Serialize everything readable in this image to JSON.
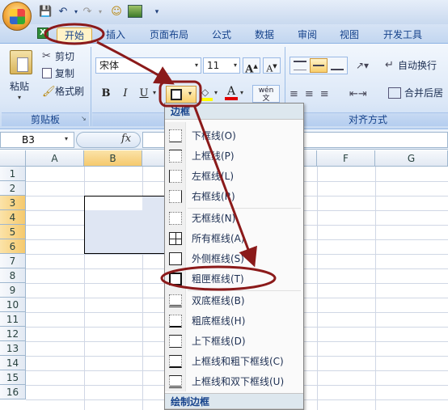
{
  "quick_access": {
    "icons": [
      "excel-office-button",
      "save-icon",
      "undo-icon",
      "redo-icon",
      "smiley-icon",
      "picture-icon",
      "customize-arrow-icon"
    ]
  },
  "tabs": {
    "home": "开始",
    "insert": "插入",
    "page_layout": "页面布局",
    "formulas": "公式",
    "data": "数据",
    "review": "审阅",
    "view": "视图",
    "developer": "开发工具"
  },
  "clipboard": {
    "paste": "粘贴",
    "cut": "剪切",
    "copy": "复制",
    "format_painter": "格式刷",
    "group_label": "剪贴板"
  },
  "font": {
    "name": "宋体",
    "size": "11",
    "bold": "B",
    "italic": "I",
    "underline": "U",
    "grow": "A",
    "shrink": "A",
    "phonetic": "wén"
  },
  "alignment": {
    "wrap_text": "自动换行",
    "merge_center": "合并后居",
    "group_label": "对齐方式"
  },
  "formula_bar": {
    "name_box": "B3",
    "fx": "fx",
    "value": ""
  },
  "columns": [
    "A",
    "B",
    "C",
    "D",
    "E",
    "F",
    "G"
  ],
  "rows": [
    "1",
    "2",
    "3",
    "4",
    "5",
    "6",
    "7",
    "8",
    "9",
    "10",
    "11",
    "12",
    "13",
    "14",
    "15",
    "16"
  ],
  "border_menu": {
    "header": "边框",
    "items": [
      "下框线(O)",
      "上框线(P)",
      "左框线(L)",
      "右框线(R)",
      "无框线(N)",
      "所有框线(A)",
      "外侧框线(S)",
      "粗匣框线(T)",
      "双底框线(B)",
      "粗底框线(H)",
      "上下框线(D)",
      "上框线和粗下框线(C)",
      "上框线和双下框线(U)"
    ],
    "footer_header": "绘制边框",
    "highlighted_item": "粗匣框线(T)"
  },
  "colors": {
    "annotation": "#8b1a1a",
    "highlight_fill": "#fbe3a9",
    "selection_fill": "#dfe6f3",
    "menu_header": "#dde7ee"
  }
}
